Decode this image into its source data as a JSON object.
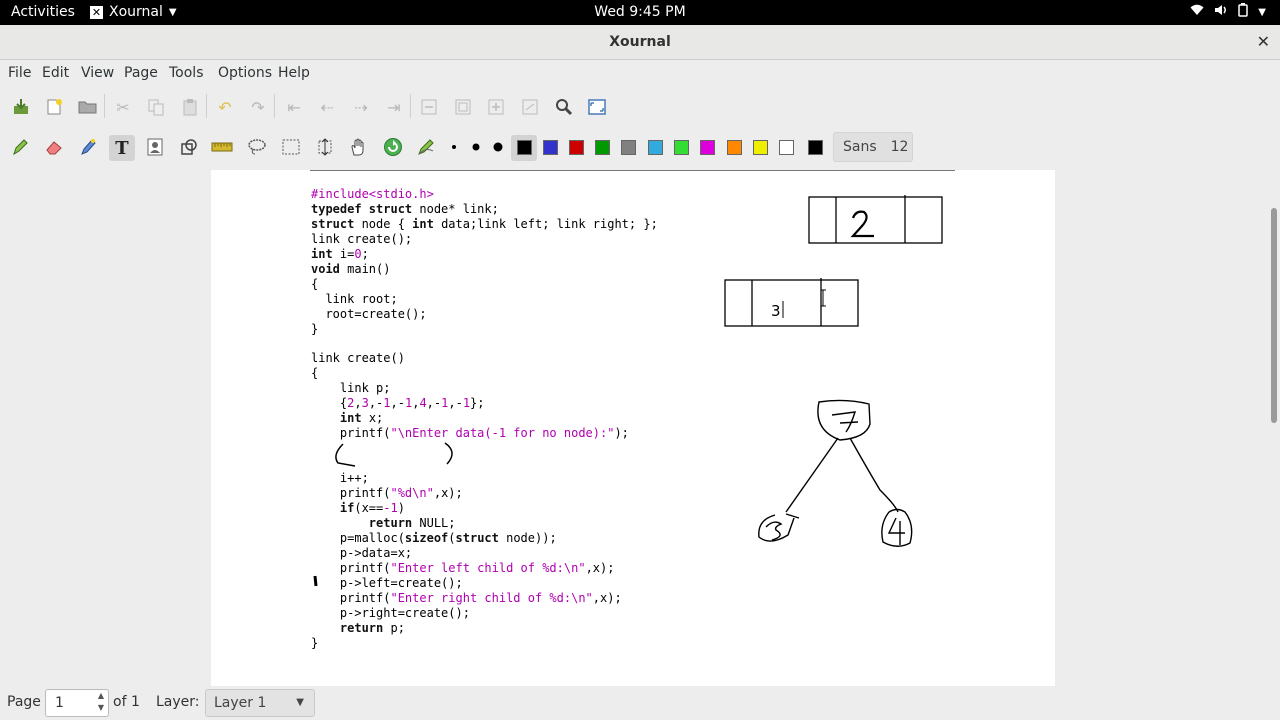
{
  "system_bar": {
    "activities": "Activities",
    "app_name": "Xournal",
    "clock": "Wed  9:45 PM"
  },
  "window": {
    "title": "Xournal",
    "close_glyph": "✕"
  },
  "menu": [
    "File",
    "Edit",
    "View",
    "Page",
    "Tools",
    "Options",
    "Help"
  ],
  "toolbar": {
    "font_name": "Sans",
    "font_size": "12",
    "colors": [
      "#000000",
      "#3333cc",
      "#cc0000",
      "#009900",
      "#808080",
      "#33aadd",
      "#33dd33",
      "#dd00dd",
      "#ff8800",
      "#eeee00",
      "#ffffff",
      "#000000"
    ]
  },
  "code_lines": [
    [
      {
        "t": "#include<stdio.h>",
        "c": "pp"
      }
    ],
    [
      {
        "t": "typedef struct",
        "c": "kw"
      },
      {
        "t": " node* link;"
      }
    ],
    [
      {
        "t": "struct",
        "c": "kw"
      },
      {
        "t": " node { "
      },
      {
        "t": "int",
        "c": "kw"
      },
      {
        "t": " data;link left; link right; };"
      }
    ],
    [
      {
        "t": "link create();"
      }
    ],
    [
      {
        "t": "int",
        "c": "kw"
      },
      {
        "t": " i="
      },
      {
        "t": "0",
        "c": "num"
      },
      {
        "t": ";"
      }
    ],
    [
      {
        "t": "void",
        "c": "kw"
      },
      {
        "t": " main()"
      }
    ],
    [
      {
        "t": "{"
      }
    ],
    [
      {
        "t": "  link root;"
      }
    ],
    [
      {
        "t": "  root=create();"
      }
    ],
    [
      {
        "t": "}"
      }
    ],
    [
      {
        "t": ""
      }
    ],
    [
      {
        "t": "link create()"
      }
    ],
    [
      {
        "t": "{"
      }
    ],
    [
      {
        "t": "    link p;"
      }
    ],
    [
      {
        "t": "    {"
      },
      {
        "t": "2",
        "c": "num"
      },
      {
        "t": ","
      },
      {
        "t": "3",
        "c": "num"
      },
      {
        "t": ",-"
      },
      {
        "t": "1",
        "c": "num"
      },
      {
        "t": ",-"
      },
      {
        "t": "1",
        "c": "num"
      },
      {
        "t": ","
      },
      {
        "t": "4",
        "c": "num"
      },
      {
        "t": ",-"
      },
      {
        "t": "1",
        "c": "num"
      },
      {
        "t": ",-"
      },
      {
        "t": "1",
        "c": "num"
      },
      {
        "t": "};"
      }
    ],
    [
      {
        "t": "    "
      },
      {
        "t": "int",
        "c": "kw"
      },
      {
        "t": " x;"
      }
    ],
    [
      {
        "t": "    printf("
      },
      {
        "t": "\"\\nEnter data(-1 for no node):\"",
        "c": "str"
      },
      {
        "t": ");"
      }
    ],
    [
      {
        "t": ""
      }
    ],
    [
      {
        "t": ""
      }
    ],
    [
      {
        "t": "    i++;"
      }
    ],
    [
      {
        "t": "    printf("
      },
      {
        "t": "\"%d\\n\"",
        "c": "str"
      },
      {
        "t": ",x);"
      }
    ],
    [
      {
        "t": "    "
      },
      {
        "t": "if",
        "c": "kw"
      },
      {
        "t": "(x=="
      },
      {
        "t": "-1",
        "c": "num"
      },
      {
        "t": ")"
      }
    ],
    [
      {
        "t": "        "
      },
      {
        "t": "return",
        "c": "kw"
      },
      {
        "t": " NULL;"
      }
    ],
    [
      {
        "t": "    p=malloc("
      },
      {
        "t": "sizeof",
        "c": "kw"
      },
      {
        "t": "("
      },
      {
        "t": "struct",
        "c": "kw"
      },
      {
        "t": " node));"
      }
    ],
    [
      {
        "t": "    p->data=x;"
      }
    ],
    [
      {
        "t": "    printf("
      },
      {
        "t": "\"Enter left child of %d:\\n\"",
        "c": "str"
      },
      {
        "t": ",x);"
      }
    ],
    [
      {
        "t": "    p->left=create();"
      }
    ],
    [
      {
        "t": "    printf("
      },
      {
        "t": "\"Enter right child of %d:\\n\"",
        "c": "str"
      },
      {
        "t": ",x);"
      }
    ],
    [
      {
        "t": "    p->right=create();"
      }
    ],
    [
      {
        "t": "    "
      },
      {
        "t": "return",
        "c": "kw"
      },
      {
        "t": " p;"
      }
    ],
    [
      {
        "t": "}"
      }
    ]
  ],
  "text_cursor_value": "3",
  "status": {
    "page_label": "Page",
    "page_value": "1",
    "of_label": "of 1",
    "layer_label": "Layer:",
    "layer_value": "Layer 1"
  }
}
